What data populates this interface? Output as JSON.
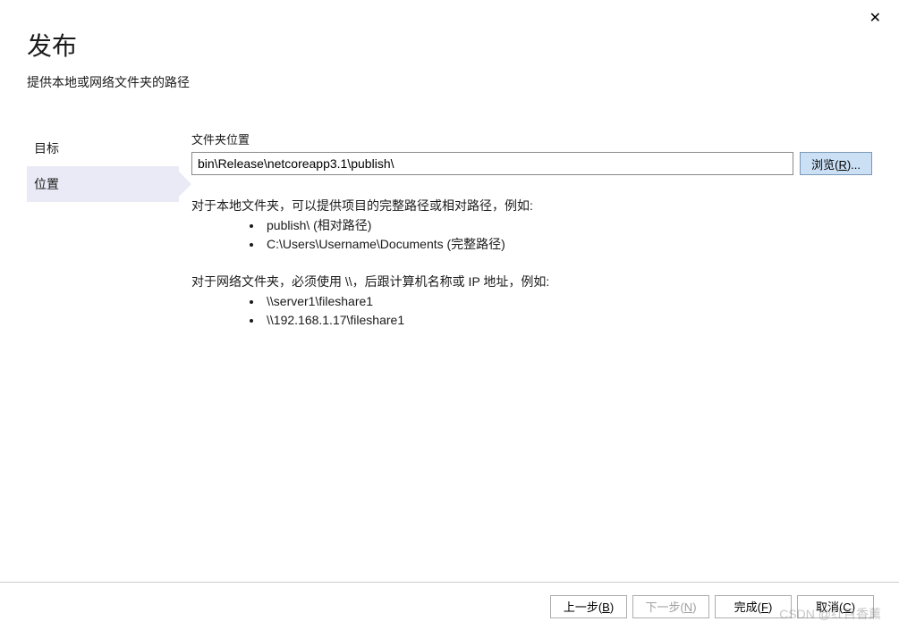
{
  "close_label": "✕",
  "header": {
    "title": "发布",
    "subtitle": "提供本地或网络文件夹的路径"
  },
  "sidebar": {
    "items": [
      {
        "label": "目标"
      },
      {
        "label": "位置"
      }
    ]
  },
  "main": {
    "folder_label": "文件夹位置",
    "folder_value": "bin\\Release\\netcoreapp3.1\\publish\\",
    "browse_label": "浏览(",
    "browse_accel": "R",
    "browse_suffix": ")...",
    "help": {
      "para1": "对于本地文件夹，可以提供项目的完整路径或相对路径，例如:",
      "local": [
        "publish\\ (相对路径)",
        "C:\\Users\\Username\\Documents (完整路径)"
      ],
      "para2": "对于网络文件夹，必须使用 \\\\，后跟计算机名称或 IP 地址，例如:",
      "net": [
        "\\\\server1\\fileshare1",
        "\\\\192.168.1.17\\fileshare1"
      ]
    }
  },
  "footer": {
    "back": {
      "prefix": "上一步(",
      "accel": "B",
      "suffix": ")"
    },
    "next": {
      "prefix": "下一步(",
      "accel": "N",
      "suffix": ")"
    },
    "finish": {
      "prefix": "完成(",
      "accel": "F",
      "suffix": ")"
    },
    "cancel": {
      "prefix": "取消(",
      "accel": "C",
      "suffix": ")"
    }
  },
  "watermark": "CSDN @红目香薰"
}
